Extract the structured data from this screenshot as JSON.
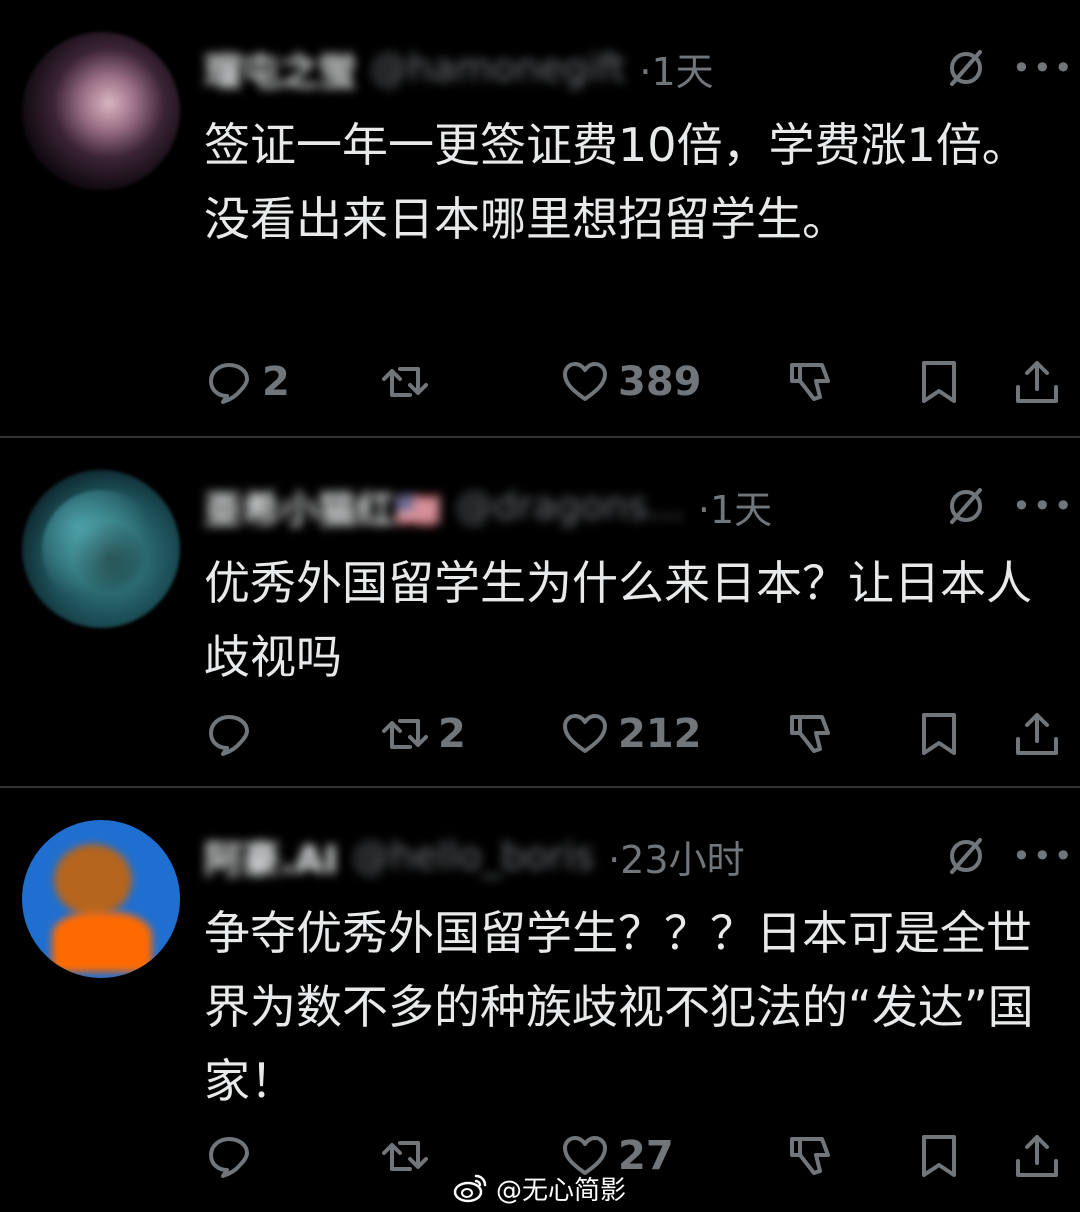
{
  "tweets": [
    {
      "name": "瑠屯之蛍",
      "handle": "@hamonegift",
      "time": "·1天",
      "text": "签证一年一更签证费10倍，学费涨1倍。没看出来日本哪里想招留学生。",
      "replies": "2",
      "retweets": "",
      "likes": "389"
    },
    {
      "name": "亜希小猫红🇺🇸",
      "handle": "@dragons...",
      "time": "·1天",
      "text": "优秀外国留学生为什么来日本？让日本人歧视吗",
      "replies": "",
      "retweets": "2",
      "likes": "212"
    },
    {
      "name": "阿豪.AI",
      "handle": "@hello_boris",
      "time": "·23小时",
      "text": "争夺优秀外国留学生？？？日本可是全世界为数不多的种族歧视不犯法的“发达”国家！",
      "replies": "",
      "retweets": "",
      "likes": "27"
    }
  ],
  "icons": {
    "grok": "grok-icon",
    "more": "more-icon",
    "reply": "reply-icon",
    "retweet": "retweet-icon",
    "like": "heart-icon",
    "dislike": "dislike-icon",
    "bookmark": "bookmark-icon",
    "share": "share-icon"
  },
  "watermark": {
    "text": "@无心简影"
  },
  "colors": {
    "background": "#000000",
    "text": "#e7e9ea",
    "secondary": "#71767b",
    "divider": "#2f3336"
  }
}
